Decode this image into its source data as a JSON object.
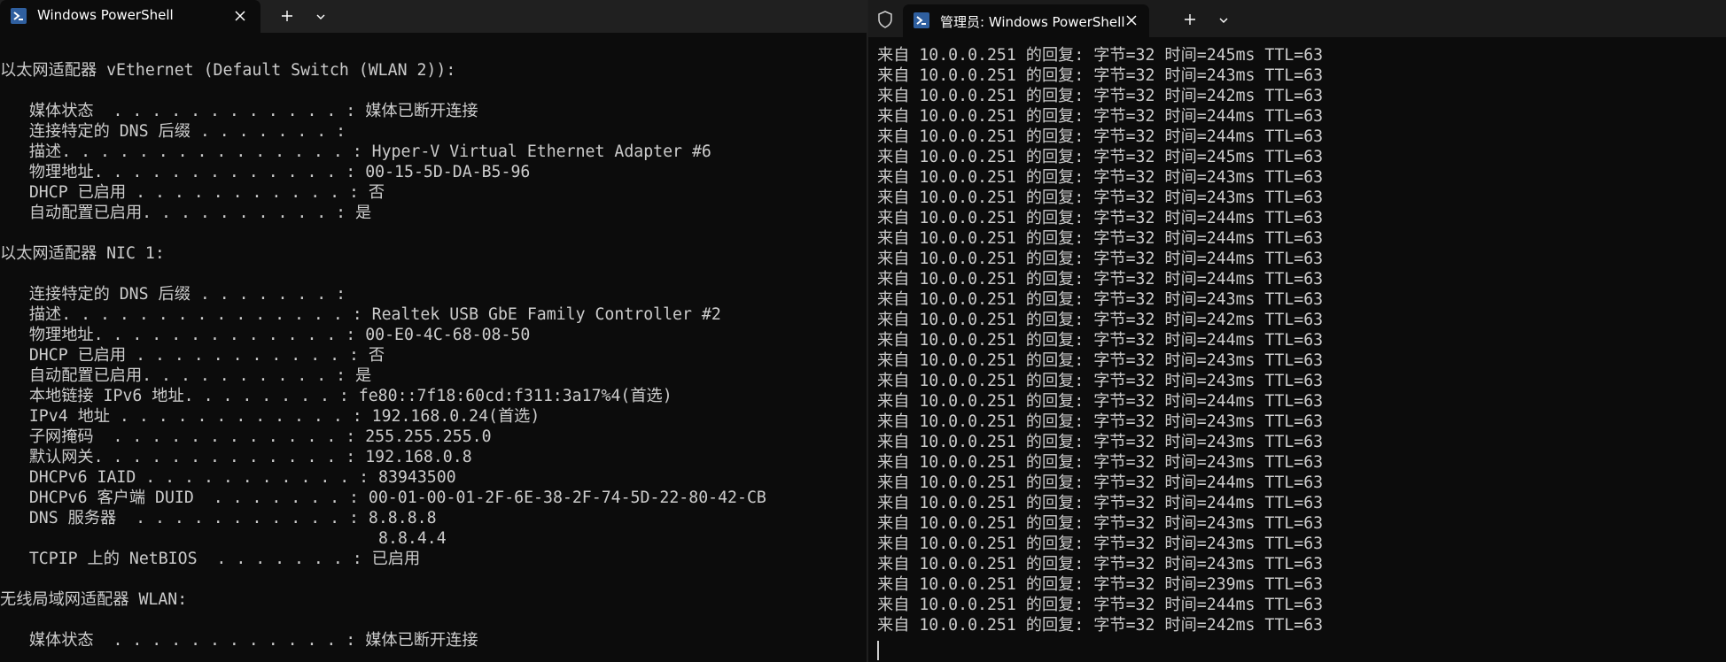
{
  "left_window": {
    "tab_title": "Windows PowerShell",
    "output": [
      "以太网适配器 vEthernet (Default Switch (WLAN 2)):",
      "",
      "   媒体状态  . . . . . . . . . . . . : 媒体已断开连接",
      "   连接特定的 DNS 后缀 . . . . . . . :",
      "   描述. . . . . . . . . . . . . . . : Hyper-V Virtual Ethernet Adapter #6",
      "   物理地址. . . . . . . . . . . . . : 00-15-5D-DA-B5-96",
      "   DHCP 已启用 . . . . . . . . . . . : 否",
      "   自动配置已启用. . . . . . . . . . : 是",
      "",
      "以太网适配器 NIC 1:",
      "",
      "   连接特定的 DNS 后缀 . . . . . . . :",
      "   描述. . . . . . . . . . . . . . . : Realtek USB GbE Family Controller #2",
      "   物理地址. . . . . . . . . . . . . : 00-E0-4C-68-08-50",
      "   DHCP 已启用 . . . . . . . . . . . : 否",
      "   自动配置已启用. . . . . . . . . . : 是",
      "   本地链接 IPv6 地址. . . . . . . . : fe80::7f18:60cd:f311:3a17%4(首选)",
      "   IPv4 地址 . . . . . . . . . . . . : 192.168.0.24(首选)",
      "   子网掩码  . . . . . . . . . . . . : 255.255.255.0",
      "   默认网关. . . . . . . . . . . . . : 192.168.0.8",
      "   DHCPv6 IAID . . . . . . . . . . . : 83943500",
      "   DHCPv6 客户端 DUID  . . . . . . . : 00-01-00-01-2F-6E-38-2F-74-5D-22-80-42-CB",
      "   DNS 服务器  . . . . . . . . . . . : 8.8.8.8",
      "                                       8.8.4.4",
      "   TCPIP 上的 NetBIOS  . . . . . . . : 已启用",
      "",
      "无线局域网适配器 WLAN:",
      "",
      "   媒体状态  . . . . . . . . . . . . : 媒体已断开连接"
    ]
  },
  "right_window": {
    "tab_title": "管理员: Windows PowerShell",
    "output": [
      "来自 10.0.0.251 的回复: 字节=32 时间=245ms TTL=63",
      "来自 10.0.0.251 的回复: 字节=32 时间=243ms TTL=63",
      "来自 10.0.0.251 的回复: 字节=32 时间=242ms TTL=63",
      "来自 10.0.0.251 的回复: 字节=32 时间=244ms TTL=63",
      "来自 10.0.0.251 的回复: 字节=32 时间=244ms TTL=63",
      "来自 10.0.0.251 的回复: 字节=32 时间=245ms TTL=63",
      "来自 10.0.0.251 的回复: 字节=32 时间=243ms TTL=63",
      "来自 10.0.0.251 的回复: 字节=32 时间=243ms TTL=63",
      "来自 10.0.0.251 的回复: 字节=32 时间=244ms TTL=63",
      "来自 10.0.0.251 的回复: 字节=32 时间=244ms TTL=63",
      "来自 10.0.0.251 的回复: 字节=32 时间=244ms TTL=63",
      "来自 10.0.0.251 的回复: 字节=32 时间=244ms TTL=63",
      "来自 10.0.0.251 的回复: 字节=32 时间=243ms TTL=63",
      "来自 10.0.0.251 的回复: 字节=32 时间=242ms TTL=63",
      "来自 10.0.0.251 的回复: 字节=32 时间=244ms TTL=63",
      "来自 10.0.0.251 的回复: 字节=32 时间=243ms TTL=63",
      "来自 10.0.0.251 的回复: 字节=32 时间=243ms TTL=63",
      "来自 10.0.0.251 的回复: 字节=32 时间=244ms TTL=63",
      "来自 10.0.0.251 的回复: 字节=32 时间=243ms TTL=63",
      "来自 10.0.0.251 的回复: 字节=32 时间=243ms TTL=63",
      "来自 10.0.0.251 的回复: 字节=32 时间=243ms TTL=63",
      "来自 10.0.0.251 的回复: 字节=32 时间=244ms TTL=63",
      "来自 10.0.0.251 的回复: 字节=32 时间=244ms TTL=63",
      "来自 10.0.0.251 的回复: 字节=32 时间=243ms TTL=63",
      "来自 10.0.0.251 的回复: 字节=32 时间=243ms TTL=63",
      "来自 10.0.0.251 的回复: 字节=32 时间=243ms TTL=63",
      "来自 10.0.0.251 的回复: 字节=32 时间=239ms TTL=63",
      "来自 10.0.0.251 的回复: 字节=32 时间=244ms TTL=63",
      "来自 10.0.0.251 的回复: 字节=32 时间=242ms TTL=63"
    ]
  },
  "colors": {
    "background": "#0c0c0c",
    "text": "#cccccc",
    "tab_text": "#ffffff",
    "ps_icon": "#2f5f9f"
  },
  "icons": [
    "powershell-icon",
    "close-icon",
    "new-tab-icon",
    "chevron-down-icon",
    "shield-icon"
  ]
}
